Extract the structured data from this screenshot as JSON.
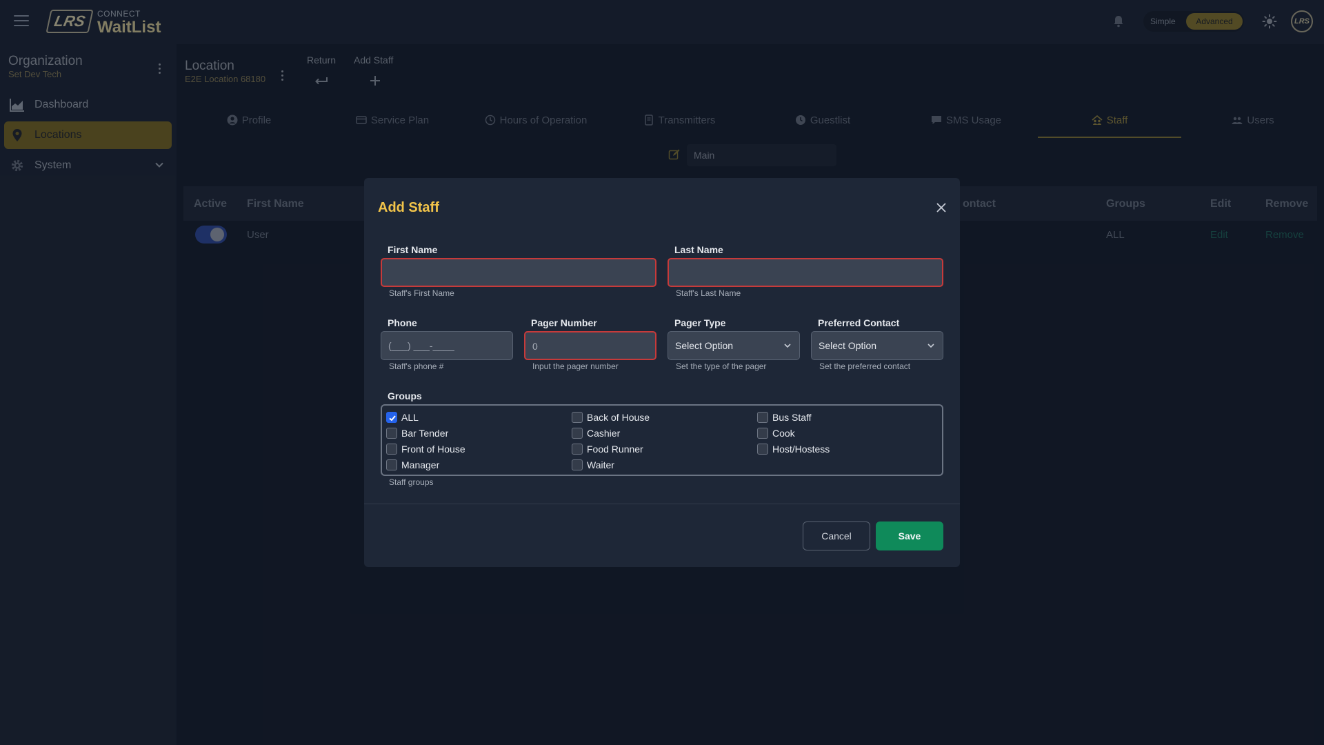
{
  "brand": {
    "logo_text": "LRS",
    "connect": "CONNECT",
    "app_name": "WaitList",
    "accent": "#f2c44a"
  },
  "header": {
    "mode_simple": "Simple",
    "mode_advanced": "Advanced",
    "avatar_text": "LRS"
  },
  "sidebar": {
    "org_title": "Organization",
    "org_sub": "Set Dev Tech",
    "items": [
      {
        "label": "Dashboard",
        "icon": "chart-icon"
      },
      {
        "label": "Locations",
        "icon": "location-pin-icon",
        "active": true
      },
      {
        "label": "System",
        "icon": "gear-icon"
      }
    ]
  },
  "location": {
    "title": "Location",
    "sub": "E2E Location 68180",
    "actions": [
      {
        "label": "Return"
      },
      {
        "label": "Add Staff"
      }
    ]
  },
  "tabs": [
    {
      "label": "Profile"
    },
    {
      "label": "Service Plan"
    },
    {
      "label": "Hours of Operation"
    },
    {
      "label": "Transmitters"
    },
    {
      "label": "Guestlist"
    },
    {
      "label": "SMS Usage"
    },
    {
      "label": "Staff",
      "active": true
    },
    {
      "label": "Users"
    }
  ],
  "staff_list": {
    "selected": "Main"
  },
  "table": {
    "headers": {
      "active": "Active",
      "first_name": "First Name",
      "contact": "ontact",
      "groups": "Groups",
      "edit": "Edit",
      "remove": "Remove"
    },
    "rows": [
      {
        "active": true,
        "first_name": "User",
        "groups": "ALL",
        "edit": "Edit",
        "remove": "Remove"
      }
    ]
  },
  "modal": {
    "title": "Add Staff",
    "first_name": {
      "label": "First Name",
      "value": "",
      "help": "Staff's First Name"
    },
    "last_name": {
      "label": "Last Name",
      "value": "",
      "help": "Staff's Last Name"
    },
    "phone": {
      "label": "Phone",
      "placeholder": "(___) ___-____",
      "help": "Staff's phone #"
    },
    "pager_number": {
      "label": "Pager Number",
      "value": "0",
      "help": "Input the pager number"
    },
    "pager_type": {
      "label": "Pager Type",
      "selected": "Select Option",
      "help": "Set the type of the pager"
    },
    "preferred_contact": {
      "label": "Preferred Contact",
      "selected": "Select Option",
      "help": "Set the preferred contact"
    },
    "groups": {
      "label": "Groups",
      "help": "Staff groups",
      "options": [
        {
          "label": "ALL",
          "checked": true
        },
        {
          "label": "Back of House",
          "checked": false
        },
        {
          "label": "Bus Staff",
          "checked": false
        },
        {
          "label": "Bar Tender",
          "checked": false
        },
        {
          "label": "Cashier",
          "checked": false
        },
        {
          "label": "Cook",
          "checked": false
        },
        {
          "label": "Front of House",
          "checked": false
        },
        {
          "label": "Food Runner",
          "checked": false
        },
        {
          "label": "Host/Hostess",
          "checked": false
        },
        {
          "label": "Manager",
          "checked": false
        },
        {
          "label": "Waiter",
          "checked": false
        }
      ]
    },
    "cancel_label": "Cancel",
    "save_label": "Save"
  }
}
